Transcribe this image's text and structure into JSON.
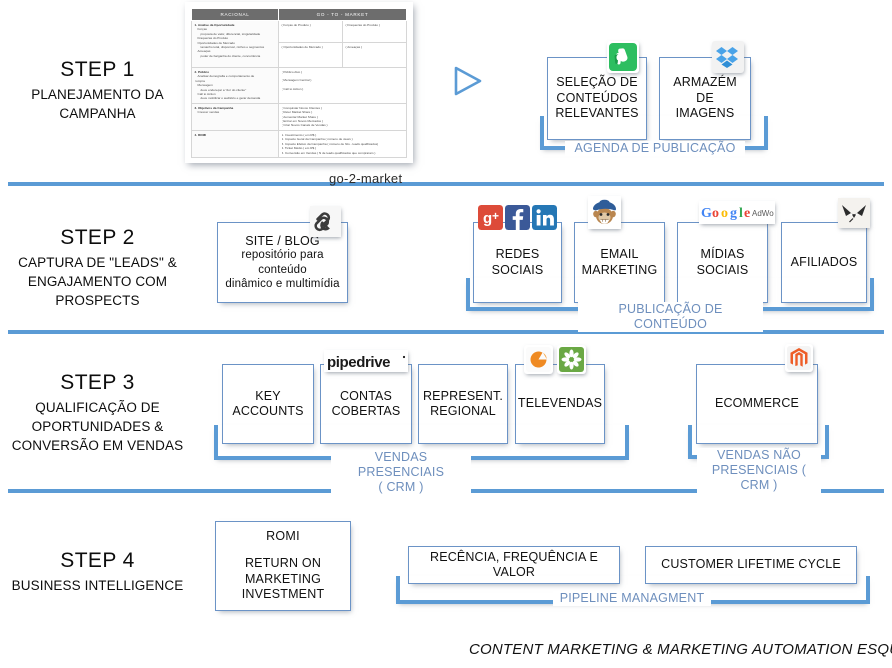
{
  "document": {
    "caption": "go-2-market",
    "table": {
      "headers": [
        "RACIONAL",
        "GO - TO - MARKET"
      ],
      "rows": [
        {
          "rational": {
            "head": "1. Analise da Oportunidade",
            "lines": [
              "Forças",
              "proposta de valor, diferencial, singularidade",
              "Fraquezas do Produto",
              "Oportunidades de Mercado",
              "tamanho total, disponível, nichos e segmentos",
              "Ameaças",
              "poder de barganha do cliente, concorrência"
            ]
          },
          "market_left": [
            "( Forças do Produto )",
            "( Oportunidades de Mercado )"
          ],
          "market_right": [
            "( Fraquezas do Produto )",
            "( Ameaças )"
          ]
        },
        {
          "rational": {
            "head": "2. Público",
            "lines": [
              "Analisar demografia e comportamento de",
              "compra",
              "Mensagem",
              "deve endereçar a \"dor do cliente\"",
              "Call to Action",
              "deve mobilizar o auditório e gerar demanda"
            ]
          },
          "market_left": [
            "( Público Alvo )",
            "( Mensagem Central )",
            "( Call to Action )"
          ],
          "market_right": []
        },
        {
          "rational": {
            "head": "3. Objetivos da Campanha",
            "lines": [
              "Crescer vendas"
            ]
          },
          "market_left": [
            "( Conquistar Novos Clientes )",
            "( Reter Market Share )",
            "( Aumentar Market Share )",
            "( Entrar em Novos Mercados )",
            "( Criar Novos Canais de Vendas )"
          ],
          "market_right": []
        },
        {
          "rational": {
            "head": "4. ROMI",
            "lines": []
          },
          "market_left": [
            "1. Investimento ( em R$ )",
            "2. Impacto Geral da Campanha ( número de views )",
            "3. Impacto Efetivo da Campanha ( número de hits - leads qualificados)",
            "4. Ticket Médio ( em R$ )",
            "5. Conversão em Vendas ( N de leads qualificados que compraram )"
          ],
          "market_right": []
        }
      ]
    }
  },
  "steps": [
    {
      "title": "STEP 1",
      "subtitle": "PLANEJAMENTO DA\nCAMPANHA"
    },
    {
      "title": "STEP 2",
      "subtitle": "CAPTURA DE \"LEADS\"\n& ENGAJAMENTO\nCOM PROSPECTS"
    },
    {
      "title": "STEP 3",
      "subtitle": "QUALIFICAÇÃO DE\nOPORTUNIDADES\n& CONVERSÃO EM\nVENDAS"
    },
    {
      "title": "STEP 4",
      "subtitle": "BUSINESS\nINTELLIGENCE"
    }
  ],
  "boxes": {
    "selecao_conteudos": "SELEÇÃO DE\nCONTEÚDOS\nRELEVANTES",
    "armazem_imagens": "ARMAZÉM DE\nIMAGENS",
    "site_blog_title": "SITE / BLOG",
    "site_blog_desc": "repositório para conteúdo\ndinâmico e multimídia",
    "redes_sociais": "REDES SOCIAIS",
    "email_marketing": "EMAIL\nMARKETING",
    "midias_sociais": "MÍDIAS SOCIAIS",
    "afiliados": "AFILIADOS",
    "key_accounts": "KEY ACCOUNTS",
    "contas_cobertas": "CONTAS\nCOBERTAS",
    "represent_regional": "REPRESENT.\nREGIONAL",
    "televendas": "TELEVENDAS",
    "ecommerce": "ECOMMERCE",
    "romi_head": "ROMI",
    "romi_body": "RETURN ON\nMARKETING\nINVESTMENT",
    "recencia": "RECÊNCIA, FREQUÊNCIA E VALOR",
    "customer_lifetime": "CUSTOMER LIFETIME CYCLE"
  },
  "brackets": {
    "agenda_publicacao": "AGENDA DE PUBLICAÇÃO",
    "publicacao_conteudo": "PUBLICAÇÃO DE CONTEÚDO",
    "vendas_presenciais": "VENDAS PRESENCIAIS\n( CRM )",
    "vendas_nao_presenciais": "VENDAS NÃO\nPRESENCIAIS ( CRM )",
    "pipeline_managment": "PIPELINE MANAGMENT"
  },
  "icons": {
    "evernote": "evernote-icon",
    "dropbox": "dropbox-icon",
    "squarespace": "squarespace-icon",
    "googleplus": "google-plus-icon",
    "facebook": "facebook-icon",
    "linkedin": "linkedin-icon",
    "mailchimp": "mailchimp-icon",
    "googleadwords": "google-adwords-icon",
    "affiliate": "affiliate-network-icon",
    "pipedrive": "pipedrive-icon",
    "callcenter": "call-center-icon",
    "contactcenter": "contact-center-icon",
    "magento": "magento-icon",
    "play": "play-arrow-icon"
  },
  "footer": {
    "note": "CONTENT MARKETING  & MARKETING AUTOMATION ESQUEMA"
  },
  "colors": {
    "accent_blue": "#5b9bd5",
    "box_border": "#6b93c6",
    "bracket_label": "#6e8fbd",
    "header_gray": "#6d6d6d"
  }
}
